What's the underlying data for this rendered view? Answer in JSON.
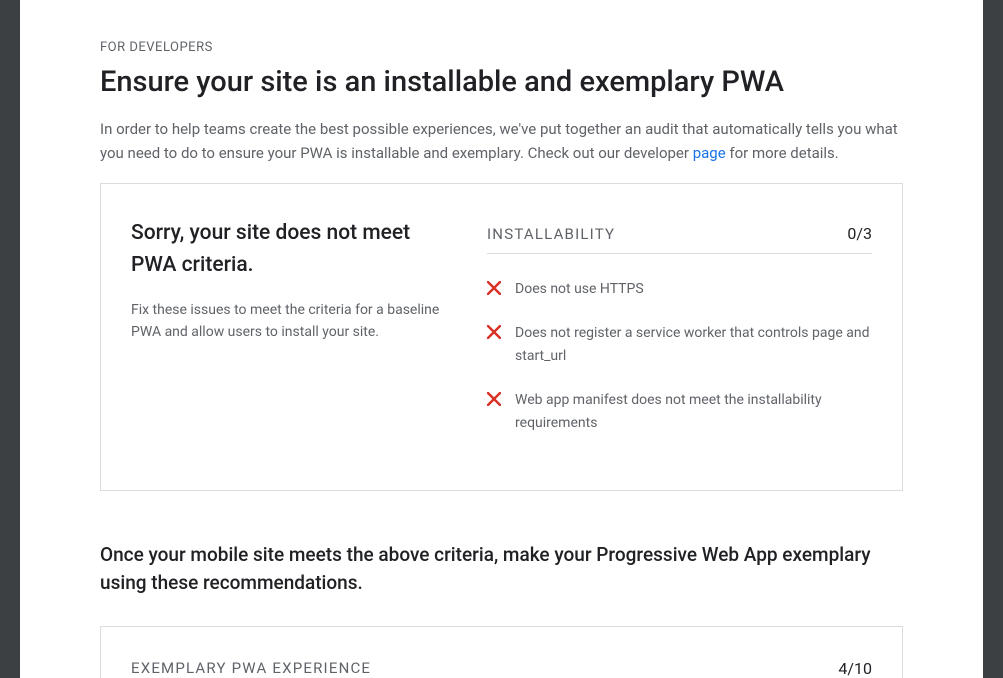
{
  "eyebrow": "FOR DEVELOPERS",
  "title": "Ensure your site is an installable and exemplary PWA",
  "intro": {
    "part1": "In order to help teams create the best possible experiences, we've put together an audit that automatically tells you what you need to do to ensure your PWA is installable and exemplary. Check out our developer ",
    "link_text": "page",
    "part2": " for more details."
  },
  "card": {
    "heading": "Sorry, your site does not meet PWA criteria.",
    "sub": "Fix these issues to meet the criteria for a baseline PWA and allow users to install your site.",
    "score_label": "INSTALLABILITY",
    "score_value": "0/3",
    "items": [
      "Does not use HTTPS",
      "Does not register a service worker that controls page and start_url",
      "Web app manifest does not meet the installability requirements"
    ]
  },
  "subheading": "Once your mobile site meets the above criteria, make your Progressive Web App exemplary using these recommendations.",
  "exemplary": {
    "label": "EXEMPLARY PWA EXPERIENCE",
    "score": "4/10"
  }
}
